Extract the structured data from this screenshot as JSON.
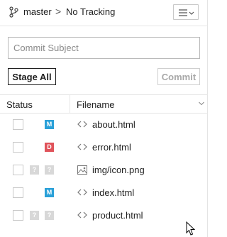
{
  "header": {
    "branch": "master",
    "separator": ">",
    "tracking": "No Tracking",
    "branch_icon": "git-branch-icon",
    "menu_icon": "menu-lines-chevron-icon"
  },
  "commit": {
    "subject_placeholder": "Commit Subject",
    "subject_value": "",
    "stage_all_label": "Stage All",
    "commit_label": "Commit"
  },
  "table": {
    "columns": [
      "Status",
      "Filename"
    ],
    "rows": [
      {
        "status": "M",
        "status_color": "#2aa0d8",
        "tracked": true,
        "icon": "code-file-icon",
        "filename": "about.html"
      },
      {
        "status": "D",
        "status_color": "#e0535a",
        "tracked": true,
        "icon": "code-file-icon",
        "filename": "error.html"
      },
      {
        "status": "?",
        "status2": "?",
        "status_color": "#d8d8d8",
        "tracked": false,
        "icon": "image-file-icon",
        "filename": "img/icon.png"
      },
      {
        "status": "M",
        "status_color": "#2aa0d8",
        "tracked": true,
        "icon": "code-file-icon",
        "filename": "index.html"
      },
      {
        "status": "?",
        "status2": "?",
        "status_color": "#d8d8d8",
        "tracked": false,
        "icon": "code-file-icon",
        "filename": "product.html"
      }
    ]
  }
}
